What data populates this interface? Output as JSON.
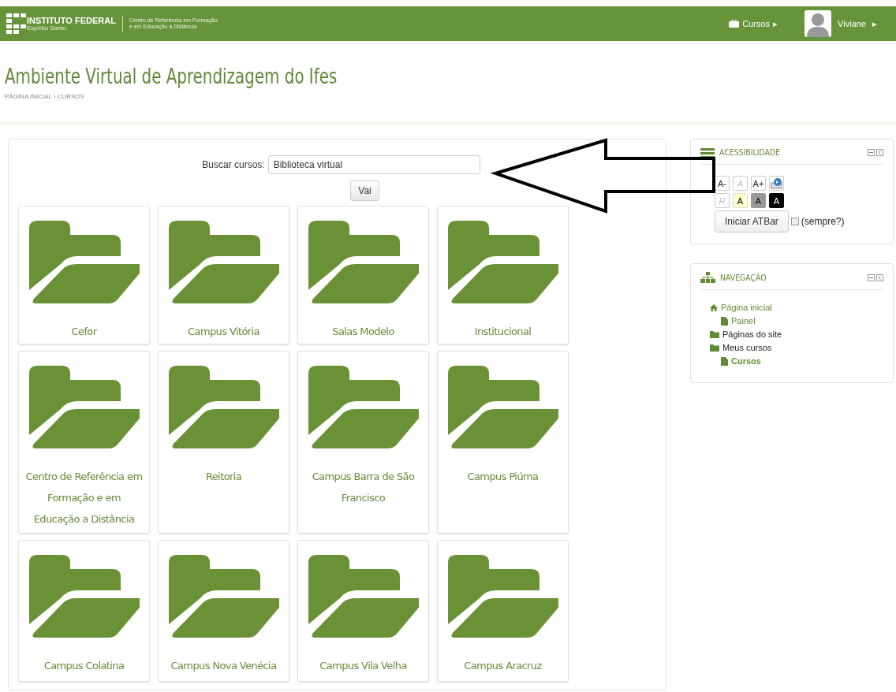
{
  "header": {
    "logo_name": "INSTITUTO FEDERAL",
    "logo_sub": "Espírito Santo",
    "center_line1": "Centro de Referência em Formação",
    "center_line2": "e em Educação a Distância",
    "menu_label": "Cursos",
    "menu_arrow": "▸",
    "user_name": "Viviane",
    "user_arrow": "▸"
  },
  "page": {
    "title": "Ambiente Virtual de Aprendizagem do Ifes",
    "breadcrumb": [
      {
        "label": "PÁGINA INICIAL"
      },
      {
        "label": "CURSOS"
      }
    ],
    "breadcrumb_separator": "›"
  },
  "search": {
    "label": "Buscar cursos:",
    "value": "Biblioteca virtual",
    "button": "Vai"
  },
  "categories": [
    {
      "name": "Cefor"
    },
    {
      "name": "Campus Vitória"
    },
    {
      "name": "Salas Modelo"
    },
    {
      "name": "Institucional"
    },
    {
      "name": "Centro de Referência em Formação e em Educação a Distância"
    },
    {
      "name": "Reitoria"
    },
    {
      "name": "Campus Barra de São Francisco"
    },
    {
      "name": "Campus Piúma"
    },
    {
      "name": "Campus Colatina"
    },
    {
      "name": "Campus Nova Venécia"
    },
    {
      "name": "Campus Vila Velha"
    },
    {
      "name": "Campus Aracruz"
    }
  ],
  "accessibility": {
    "title": "ACESSIBILIDADE",
    "rows": [
      [
        {
          "kind": "text",
          "label": "A-",
          "disabled": false
        },
        {
          "kind": "text",
          "label": "A",
          "disabled": true
        },
        {
          "kind": "text",
          "label": "A+",
          "disabled": false
        },
        {
          "kind": "icon",
          "disabled": false
        }
      ],
      [
        {
          "kind": "text",
          "label": "R",
          "disabled": true
        },
        {
          "kind": "text",
          "label": "A",
          "disabled": false,
          "color": "#ffffcc"
        },
        {
          "kind": "text",
          "label": "A",
          "disabled": false,
          "color": "#999999"
        },
        {
          "kind": "text",
          "label": "A",
          "disabled": false,
          "color": "#000000"
        }
      ]
    ],
    "start_button": "Iniciar ATBar",
    "always": {
      "label": "(sempre?)",
      "checked": false
    }
  },
  "navigation": {
    "title": "NAVEGAÇÃO",
    "items": [
      {
        "kind": "home",
        "label": "Página inicial",
        "link": true,
        "current": false,
        "children": [
          {
            "kind": "page",
            "label": "Painel",
            "link": true,
            "current": false
          }
        ]
      },
      {
        "kind": "folder",
        "label": "Páginas do site",
        "link": false,
        "current": false
      },
      {
        "kind": "folder",
        "label": "Meus cursos",
        "link": false,
        "current": false,
        "children": [
          {
            "kind": "page",
            "label": "Cursos",
            "link": true,
            "current": true
          }
        ]
      }
    ]
  }
}
